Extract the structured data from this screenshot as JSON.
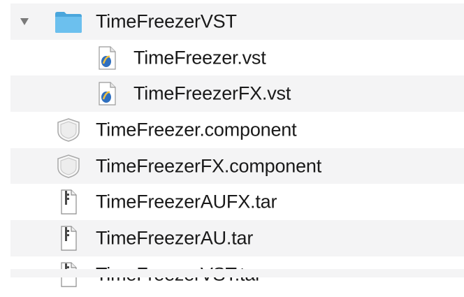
{
  "files": [
    {
      "name": "TimeFreezerVST",
      "icon": "folder-icon",
      "expanded": true,
      "level": 0
    },
    {
      "name": "TimeFreezer.vst",
      "icon": "vst-plugin-icon",
      "level": 1
    },
    {
      "name": "TimeFreezerFX.vst",
      "icon": "vst-plugin-icon",
      "level": 1
    },
    {
      "name": "TimeFreezer.component",
      "icon": "component-bundle-icon",
      "level": 0
    },
    {
      "name": "TimeFreezerFX.component",
      "icon": "component-bundle-icon",
      "level": 0
    },
    {
      "name": "TimeFreezerAUFX.tar",
      "icon": "tar-archive-icon",
      "level": 0
    },
    {
      "name": "TimeFreezerAU.tar",
      "icon": "tar-archive-icon",
      "level": 0
    },
    {
      "name": "TimeFreezerVST.tar",
      "icon": "tar-archive-icon",
      "level": 0
    }
  ],
  "colors": {
    "stripe": "#f4f4f5",
    "folder": "#5fb6e8",
    "text": "#1a1a1a"
  }
}
